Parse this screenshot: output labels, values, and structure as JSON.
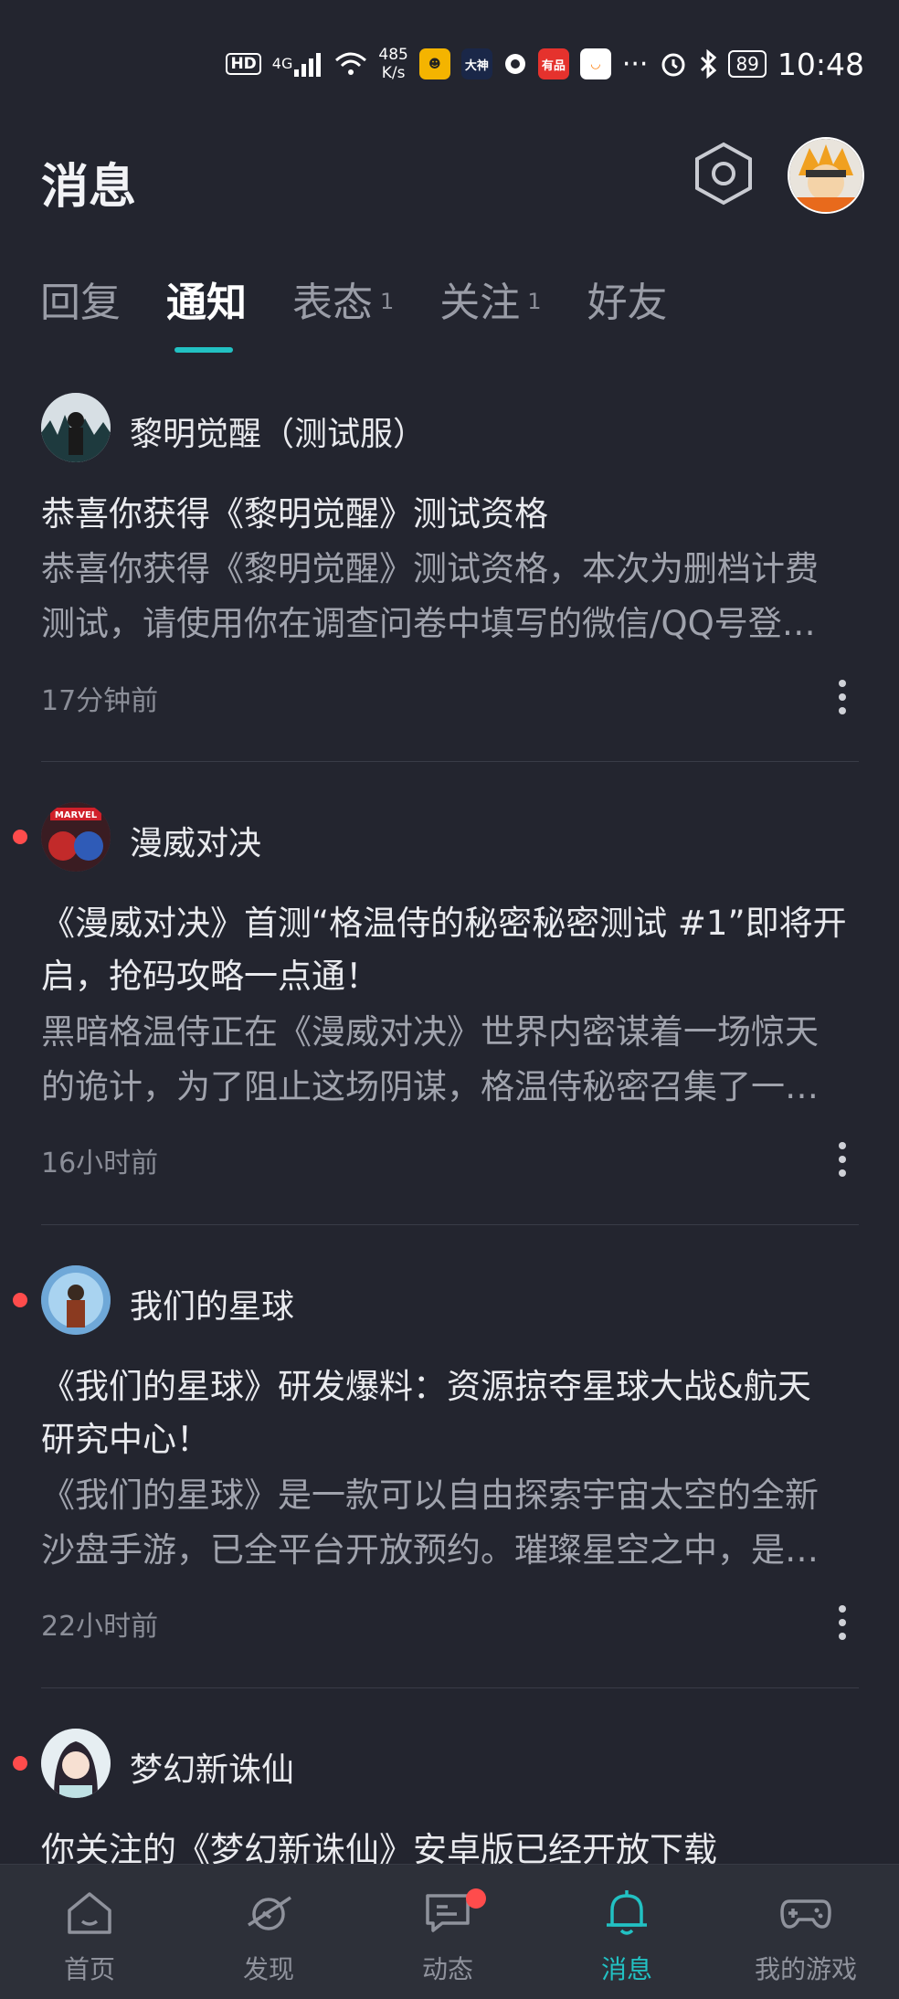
{
  "status_bar": {
    "hd": "HD",
    "network": "4G",
    "speed_value": "485",
    "speed_unit": "K/s",
    "apps": [
      "大神",
      "有品"
    ],
    "battery": "89",
    "time": "10:48"
  },
  "header": {
    "title": "消息"
  },
  "tabs": [
    {
      "label": "回复",
      "badge": ""
    },
    {
      "label": "通知",
      "badge": "",
      "active": true
    },
    {
      "label": "表态",
      "badge": "1"
    },
    {
      "label": "关注",
      "badge": "1"
    },
    {
      "label": "好友",
      "badge": ""
    }
  ],
  "notifications": [
    {
      "source": "黎明觉醒（测试服）",
      "title": "恭喜你获得《黎明觉醒》测试资格",
      "body_line1": "恭喜你获得《黎明觉醒》测试资格，本次为删档计费",
      "body_line2": "测试，请使用你在调查问卷中填写的微信/QQ号登…",
      "time": "17分钟前",
      "unread": false
    },
    {
      "source": "漫威对决",
      "title_line1": "《漫威对决》首测“格温侍的秘密秘密测试 #1”即将开",
      "title_line2": "启，抢码攻略一点通！",
      "body_line1": "黑暗格温侍正在《漫威对决》世界内密谋着一场惊天",
      "body_line2": "的诡计，为了阻止这场阴谋，格温侍秘密召集了一…",
      "time": "16小时前",
      "unread": true
    },
    {
      "source": "我们的星球",
      "title_line1": "《我们的星球》研发爆料：资源掠夺星球大战&航天",
      "title_line2": "研究中心！",
      "body_line1": "《我们的星球》是一款可以自由探索宇宙太空的全新",
      "body_line2": "沙盘手游，已全平台开放预约。璀璨星空之中，是…",
      "time": "22小时前",
      "unread": true
    },
    {
      "source": "梦幻新诛仙",
      "title": "你关注的《梦幻新诛仙》安卓版已经开放下载",
      "unread": true
    }
  ],
  "bottom_nav": [
    {
      "label": "首页",
      "icon": "home-icon"
    },
    {
      "label": "发现",
      "icon": "planet-icon"
    },
    {
      "label": "动态",
      "icon": "chat-icon"
    },
    {
      "label": "消息",
      "icon": "bell-icon",
      "active": true
    },
    {
      "label": "我的游戏",
      "icon": "gamepad-icon"
    }
  ],
  "colors": {
    "background": "#23252f",
    "accent": "#22c1c3",
    "unread": "#ff4c4c"
  }
}
